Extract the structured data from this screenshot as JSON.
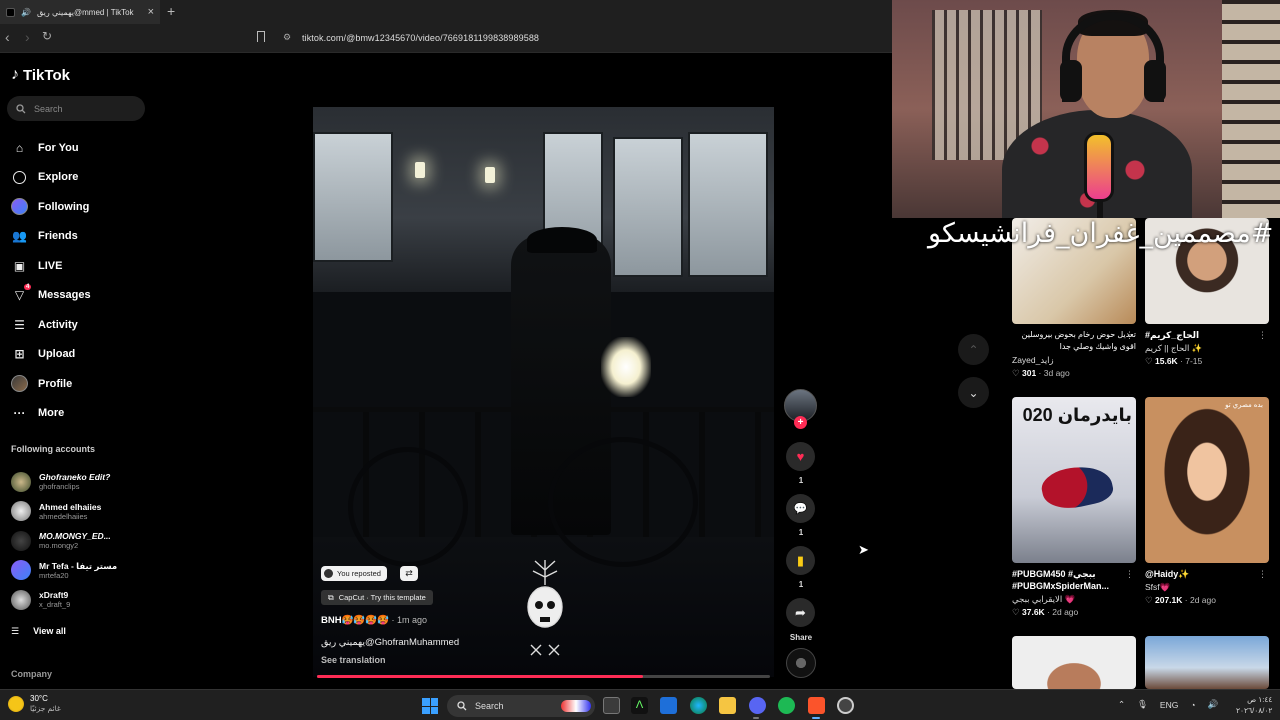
{
  "browser": {
    "tab_title": "يهميني ريق@mmed | TikTok",
    "new_tab": "+",
    "url": "tiktok.com/@bmw12345670/video/7669181199838989588"
  },
  "sidebar": {
    "brand": "TikTok",
    "search_placeholder": "Search",
    "nav": [
      {
        "label": "For You",
        "icon": "home-icon"
      },
      {
        "label": "Explore",
        "icon": "compass-icon"
      },
      {
        "label": "Following",
        "icon": "following-avatar-icon"
      },
      {
        "label": "Friends",
        "icon": "friends-icon"
      },
      {
        "label": "LIVE",
        "icon": "live-icon"
      },
      {
        "label": "Messages",
        "icon": "paper-plane-icon",
        "badge": "4"
      },
      {
        "label": "Activity",
        "icon": "activity-icon"
      },
      {
        "label": "Upload",
        "icon": "upload-icon"
      },
      {
        "label": "Profile",
        "icon": "profile-avatar-icon"
      },
      {
        "label": "More",
        "icon": "more-dots-icon"
      }
    ],
    "following_title": "Following accounts",
    "following": [
      {
        "name": "Ghofraneko Edit?",
        "handle": "ghofranclips"
      },
      {
        "name": "Ahmed elhaiies",
        "handle": "ahmedelhaiies"
      },
      {
        "name": "MO.MONGY_ED...",
        "handle": "mo.mongy2"
      },
      {
        "name": "Mr Tefa - مستر تيفا",
        "handle": "mrtefa20"
      },
      {
        "name": "xDraft9",
        "handle": "x_draft_9"
      }
    ],
    "view_all": "View all",
    "company": "Company"
  },
  "video": {
    "reposted": "You reposted",
    "capcut": "CapCut · Try this template",
    "username": "BNH🥵🥵🥵🥵",
    "time": "· 1m ago",
    "caption": "يهميني ريق@GhofranMuhammed",
    "see_translation": "See translation",
    "progress": 0.72
  },
  "actions": {
    "likes": "1",
    "comments": "1",
    "saves": "1",
    "share": "Share"
  },
  "overlay": {
    "hashtag": "#مصممين_غفران_فرانشيسكو"
  },
  "recommendations": [
    {
      "title": "تعديل حوض رخام بحوض بيروسلين اقوى واشيك وصلي جدا",
      "user": "Zayed_زايد",
      "likes": "301",
      "age": "3d ago"
    },
    {
      "title": "#الحاج_كريم",
      "user": "الحاج || كريم ✨",
      "likes": "15.6K",
      "age": "7-15"
    },
    {
      "title": "#PUBGM450 #ببجي #PUBGMxSpiderMan...",
      "user": "الايقرابي ببجي 💗",
      "likes": "37.6K",
      "age": "2d ago"
    },
    {
      "title": "@Haidy✨",
      "user": "Sfsf💗",
      "likes": "207.1K",
      "age": "2d ago"
    }
  ],
  "thumb_texts": {
    "pubg": "بايدرمان 020",
    "haidy": "بده مصري تو"
  },
  "taskbar": {
    "temp": "30°C",
    "weather": "غائم جزئيًا",
    "search": "Search",
    "lang": "ENG",
    "time": "١:٤٤ ص",
    "date": "٢٠٢٦/٠٨/٠٢"
  }
}
